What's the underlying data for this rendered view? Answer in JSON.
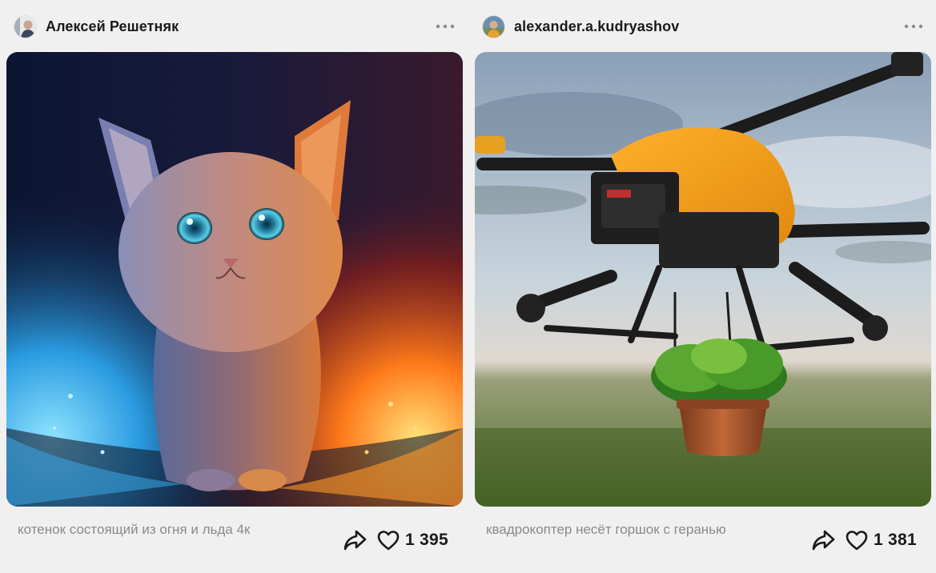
{
  "posts": [
    {
      "author": "Алексей Решетняк",
      "caption": "котенок состоящий из огня и льда 4к",
      "likes": "1 395",
      "image_subject": "glowing kitten made of fire and ice",
      "avatar_icon": "user-avatar"
    },
    {
      "author": "alexander.a.kudryashov",
      "caption": "квадрокоптер несёт горшок с геранью",
      "likes": "1 381",
      "image_subject": "orange drone carrying a potted plant over a field",
      "avatar_icon": "user-avatar"
    }
  ],
  "icons": {
    "more": "more-dots-icon",
    "share": "share-arrow-icon",
    "like": "heart-outline-icon"
  },
  "colors": {
    "background": "#f0f0f0",
    "caption_text": "#8a8a8a",
    "primary_text": "#1a1a1a"
  }
}
